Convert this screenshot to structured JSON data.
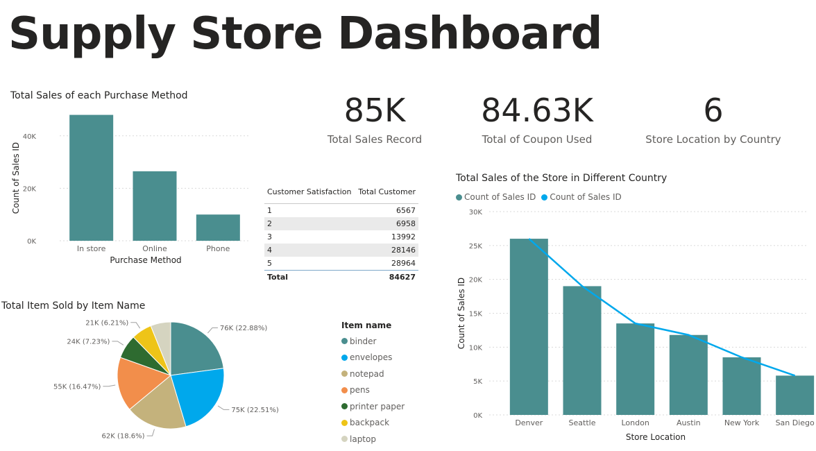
{
  "dashboard": {
    "title": "Supply Store Dashboard"
  },
  "kpis": [
    {
      "value": "85K",
      "label": "Total Sales Record"
    },
    {
      "value": "84.63K",
      "label": "Total of Coupon Used"
    },
    {
      "value": "6",
      "label": "Store Location by Country"
    }
  ],
  "satisfaction_table": {
    "headers": [
      "Customer Satisfaction",
      "Total Customer"
    ],
    "rows": [
      [
        "1",
        "6567"
      ],
      [
        "2",
        "6958"
      ],
      [
        "3",
        "13992"
      ],
      [
        "4",
        "28146"
      ],
      [
        "5",
        "28964"
      ]
    ],
    "total": [
      "Total",
      "84627"
    ]
  },
  "colors": {
    "teal": "#4a8e8f",
    "blue": "#00a8ec",
    "grid": "#d9d9d9"
  },
  "chart_data": [
    {
      "type": "bar",
      "title": "Total Sales of each Purchase Method",
      "categories": [
        "In store",
        "Online",
        "Phone"
      ],
      "values": [
        48000,
        26500,
        10000
      ],
      "xlabel": "Purchase Method",
      "ylabel": "Count of Sales ID",
      "yticks": [
        "0K",
        "20K",
        "40K"
      ],
      "ylim": [
        0,
        50000
      ],
      "grid": true
    },
    {
      "type": "pie",
      "title": "Total Item Sold by Item Name",
      "legend_title": "Item name",
      "legend_position": "right",
      "slices": [
        {
          "name": "binder",
          "label": "76K (22.88%)",
          "value": 22.88,
          "color": "#4a8e8f"
        },
        {
          "name": "envelopes",
          "label": "75K (22.51%)",
          "value": 22.51,
          "color": "#00a8ec"
        },
        {
          "name": "notepad",
          "label": "62K (18.6%)",
          "value": 18.6,
          "color": "#c4b27c"
        },
        {
          "name": "pens",
          "label": "55K (16.47%)",
          "value": 16.47,
          "color": "#f28e4b"
        },
        {
          "name": "printer paper",
          "label": "24K (7.23%)",
          "value": 7.23,
          "color": "#2e6b30"
        },
        {
          "name": "backpack",
          "label": "21K (6.21%)",
          "value": 6.21,
          "color": "#eec418"
        },
        {
          "name": "laptop",
          "label": "",
          "value": 6.1,
          "color": "#d5d4c0"
        }
      ]
    },
    {
      "type": "bar",
      "title": "Total Sales of the Store in Different Country",
      "categories": [
        "Denver",
        "Seattle",
        "London",
        "Austin",
        "New York",
        "San Diego"
      ],
      "series": [
        {
          "name": "Count of Sales ID",
          "type": "bar",
          "values": [
            26000,
            19000,
            13500,
            11800,
            8500,
            5800
          ]
        },
        {
          "name": "Count of Sales ID",
          "type": "line",
          "values": [
            26000,
            19000,
            13500,
            11800,
            8500,
            5800
          ]
        }
      ],
      "xlabel": "Store Location",
      "ylabel": "Count of Sales ID",
      "yticks": [
        "0K",
        "5K",
        "10K",
        "15K",
        "20K",
        "25K",
        "30K"
      ],
      "ylim": [
        0,
        30000
      ],
      "legend_position": "top-left",
      "grid": true
    }
  ]
}
